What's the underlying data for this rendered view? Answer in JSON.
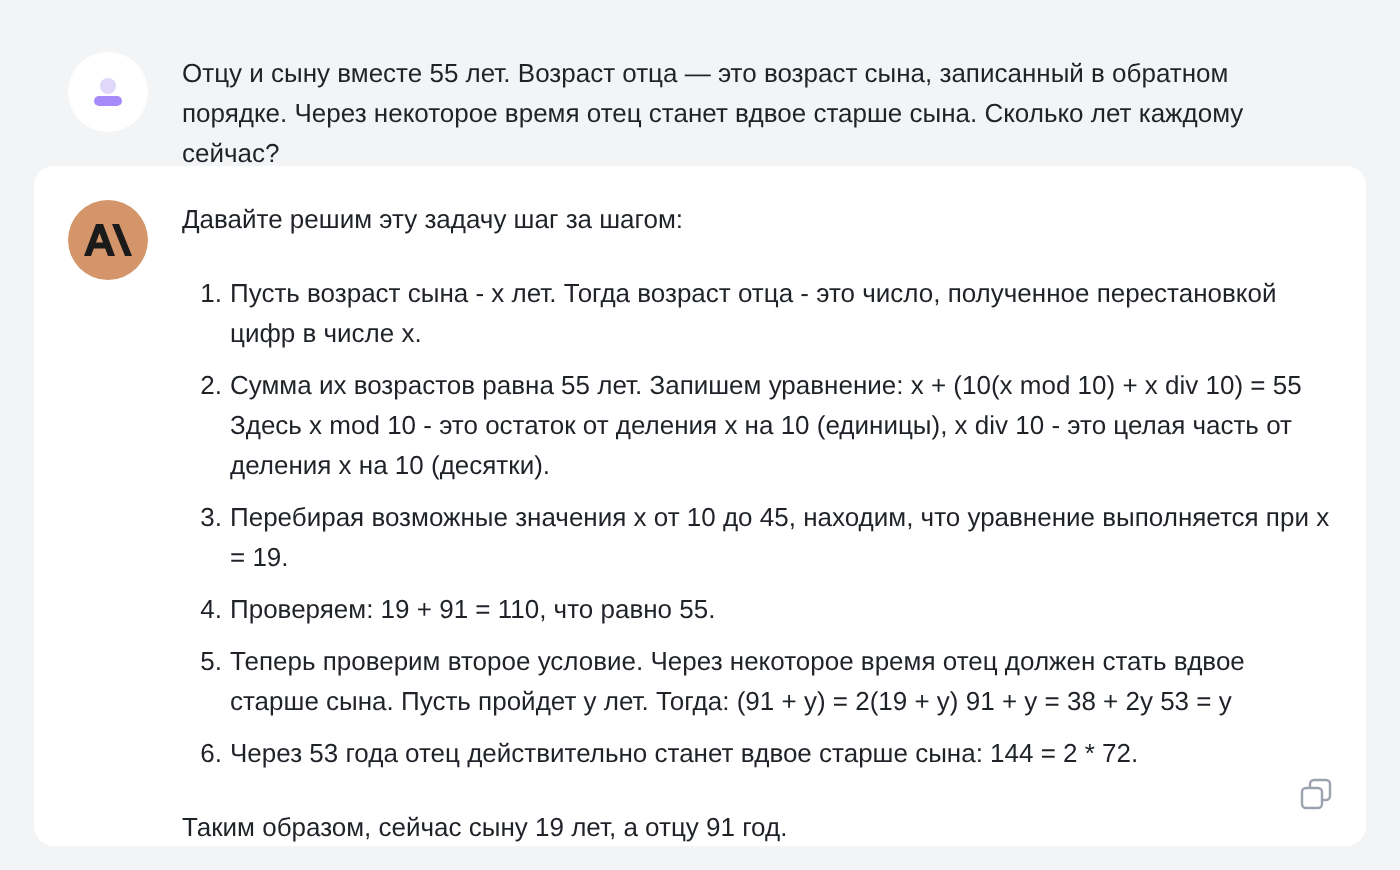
{
  "user_message": {
    "text": "Отцу и сыну вместе 55 лет. Возраст отца — это возраст сына, записанный в обратном порядке. Через некоторое время отец станет вдвое старше сына. Сколько лет каждому сейчас?"
  },
  "assistant_message": {
    "intro": "Давайте решим эту задачу шаг за шагом:",
    "steps": [
      {
        "number": "1.",
        "lines": [
          "Пусть возраст сына - x лет. Тогда возраст отца - это число, полученное перестановкой цифр в числе x."
        ]
      },
      {
        "number": "2.",
        "lines": [
          "Сумма их возрастов равна 55 лет. Запишем уравнение: x + (10(x mod 10) + x div 10) = 55",
          "Здесь x mod 10 - это остаток от деления x на 10 (единицы), x div 10 - это целая часть от деления x на 10 (десятки)."
        ]
      },
      {
        "number": "3.",
        "lines": [
          "Перебирая возможные значения x от 10 до 45, находим, что уравнение выполняется при x = 19."
        ]
      },
      {
        "number": "4.",
        "lines": [
          "Проверяем: 19 + 91 = 110, что равно 55."
        ]
      },
      {
        "number": "5.",
        "lines": [
          "Теперь проверим второе условие. Через некоторое время отец должен стать вдвое старше сына. Пусть пройдет y лет. Тогда: (91 + y) = 2(19 + y) 91 + y = 38 + 2y 53 = y"
        ]
      },
      {
        "number": "6.",
        "lines": [
          "Через 53 года отец действительно станет вдвое старше сына: 144 = 2 * 72."
        ]
      }
    ],
    "conclusion": "Таким образом, сейчас сыну 19 лет, а отцу 91 год."
  }
}
